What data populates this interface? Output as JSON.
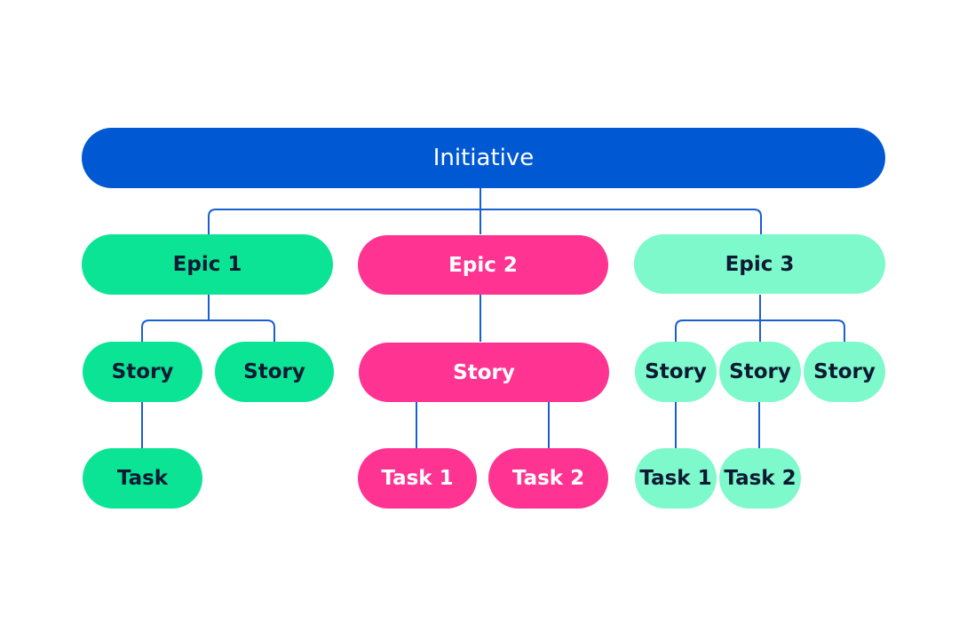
{
  "colors": {
    "initiative": "#0059D3",
    "epic1": "#0CE495",
    "epic2": "#FF3392",
    "epic3": "#7EF9CB",
    "connector": "#1A5FD0",
    "dark_text": "#0D1A33",
    "light_text": "#FFFFFF"
  },
  "initiative": {
    "label": "Initiative"
  },
  "epics": [
    {
      "label": "Epic 1",
      "stories": [
        {
          "label": "Story",
          "tasks": [
            {
              "label": "Task"
            }
          ]
        },
        {
          "label": "Story",
          "tasks": []
        }
      ]
    },
    {
      "label": "Epic 2",
      "stories": [
        {
          "label": "Story",
          "tasks": [
            {
              "label": "Task 1"
            },
            {
              "label": "Task 2"
            }
          ]
        }
      ]
    },
    {
      "label": "Epic 3",
      "stories": [
        {
          "label": "Story",
          "tasks": [
            {
              "label": "Task 1"
            }
          ]
        },
        {
          "label": "Story",
          "tasks": [
            {
              "label": "Task 2"
            }
          ]
        },
        {
          "label": "Story",
          "tasks": []
        }
      ]
    }
  ]
}
